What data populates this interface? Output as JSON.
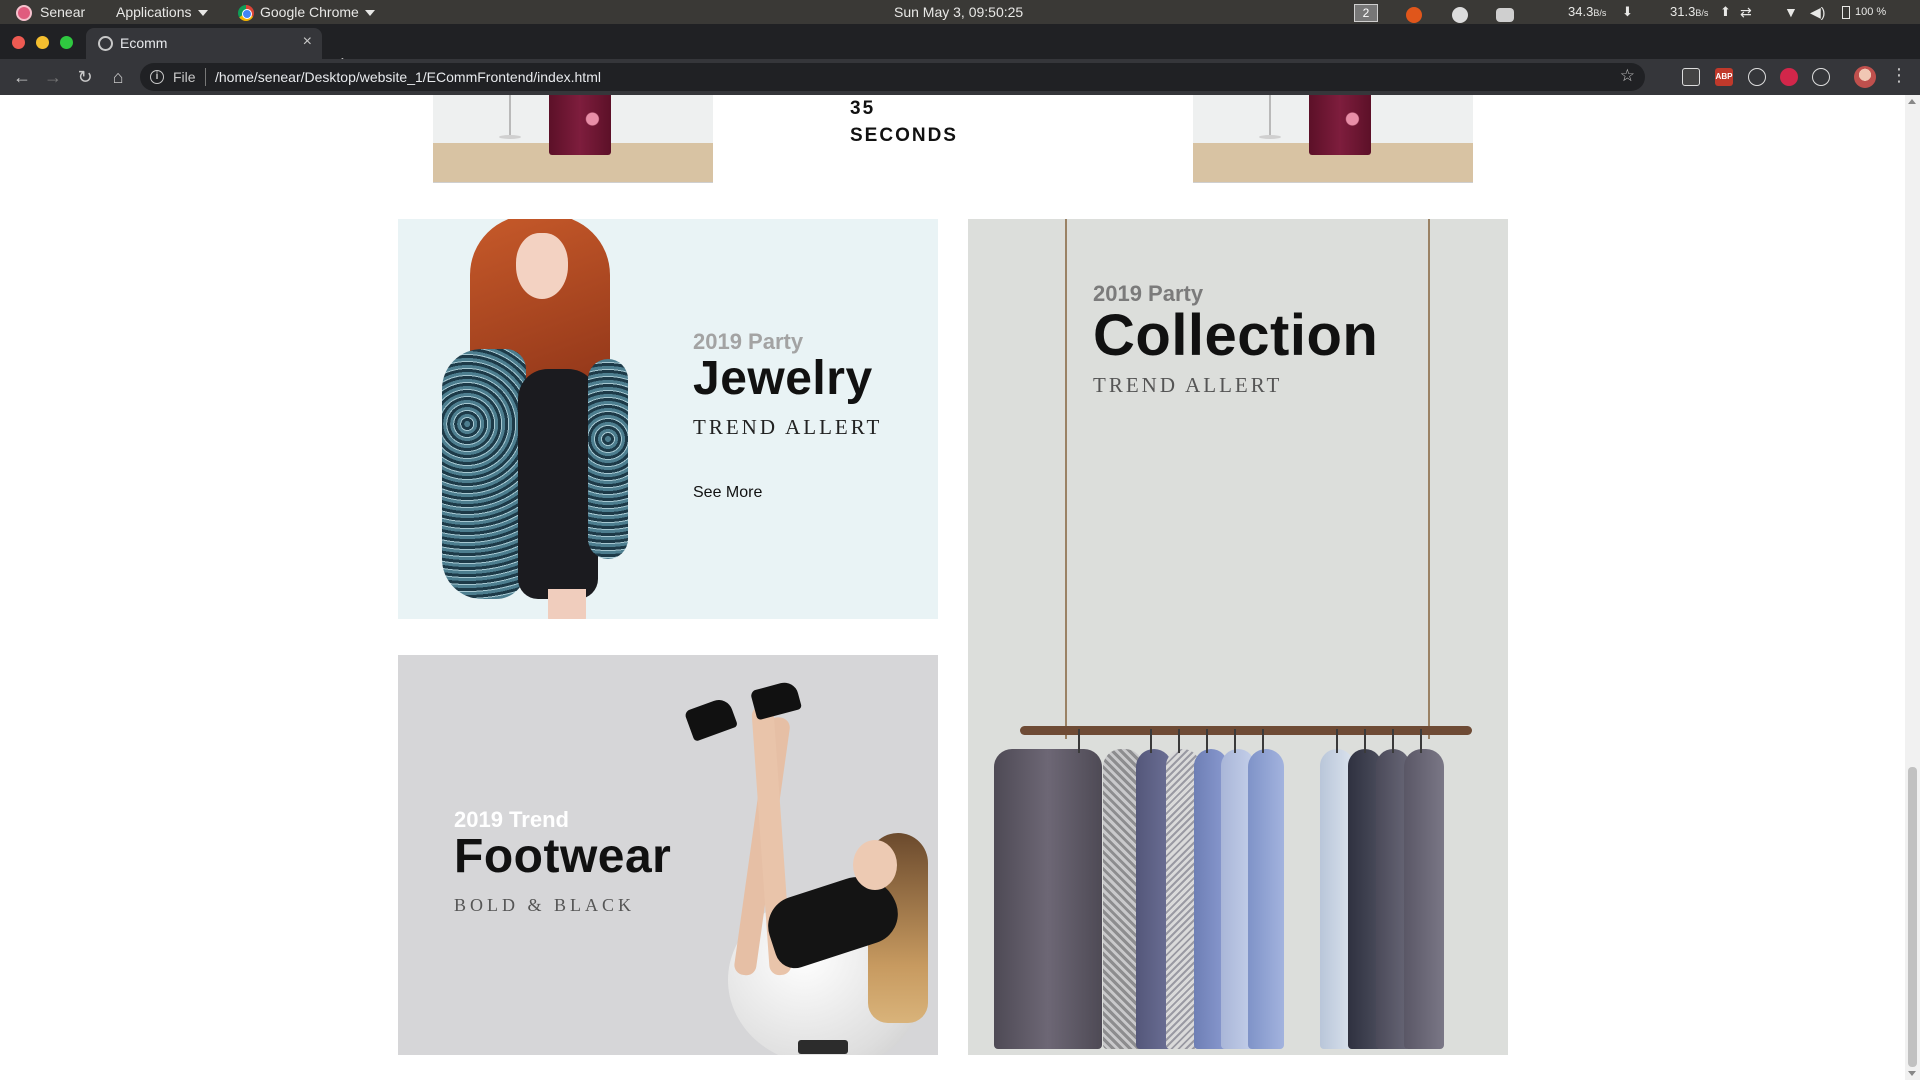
{
  "os_bar": {
    "user_menu": "Senear",
    "applications_menu": "Applications",
    "active_app": "Google Chrome",
    "clock": "Sun May  3, 09:50:25",
    "workspace": "2",
    "net_down": "34.3",
    "net_down_unit": "B/s",
    "net_up": "31.3",
    "net_up_unit": "B/s",
    "battery": "100 %"
  },
  "browser": {
    "tab_title": "Ecomm",
    "tab_close": "×",
    "new_tab": "+",
    "scheme_label": "File",
    "url": "/home/senear/Desktop/website_1/ECommFrontend/index.html",
    "extensions": [
      "ABP"
    ]
  },
  "page": {
    "countdown_value": "35",
    "countdown_unit": "SECONDS",
    "banners": {
      "jewelry": {
        "eyebrow": "2019 Party",
        "title": "Jewelry",
        "tagline": "TREND ALLERT",
        "link": "See More",
        "bg": "#e9f3f5"
      },
      "footwear": {
        "eyebrow": "2019 Trend",
        "title": "Footwear",
        "tagline": "BOLD & BLACK",
        "bg": "#d6d6d8"
      },
      "collection": {
        "eyebrow": "2019 Party",
        "title": "Collection",
        "tagline": "TREND ALLERT",
        "bg": "#dcdedb"
      }
    }
  }
}
